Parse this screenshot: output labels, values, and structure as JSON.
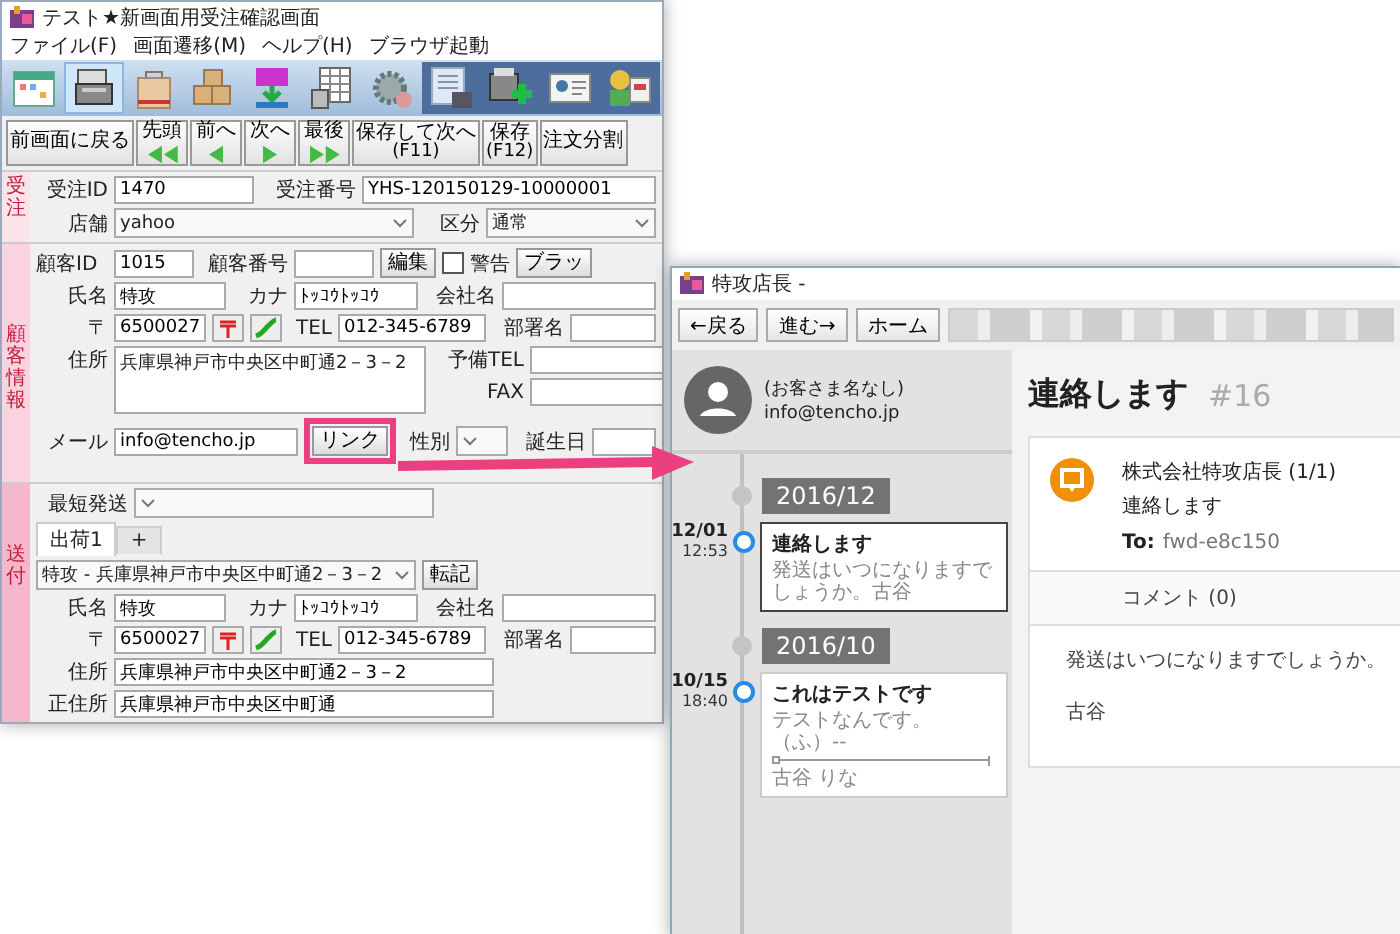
{
  "left_window": {
    "title": "テスト★新画面用受注確認画面",
    "menu": [
      "ファイル(F)",
      "画面遷移(M)",
      "ヘルプ(H)",
      "ブラウザ起動"
    ],
    "toolbar": [
      {
        "kind": "calendar",
        "selected": false,
        "dark": false
      },
      {
        "kind": "register",
        "selected": true,
        "dark": false
      },
      {
        "kind": "bag",
        "selected": false,
        "dark": false
      },
      {
        "kind": "boxes",
        "selected": false,
        "dark": false
      },
      {
        "kind": "download",
        "selected": false,
        "dark": false
      },
      {
        "kind": "sheet",
        "selected": false,
        "dark": false
      },
      {
        "kind": "gear",
        "selected": false,
        "dark": false
      },
      {
        "kind": "document",
        "selected": false,
        "dark": true
      },
      {
        "kind": "register-plus",
        "selected": false,
        "dark": true
      },
      {
        "kind": "card",
        "selected": false,
        "dark": true
      },
      {
        "kind": "person",
        "selected": false,
        "dark": true
      }
    ],
    "nav_buttons": [
      {
        "kind": "plain",
        "label": "前画面に戻る"
      },
      {
        "kind": "first",
        "label": "先頭"
      },
      {
        "kind": "prev",
        "label": "前へ"
      },
      {
        "kind": "next",
        "label": "次へ"
      },
      {
        "kind": "last",
        "label": "最後"
      },
      {
        "kind": "two-line",
        "label": "保存して次へ",
        "sub": "(F11)"
      },
      {
        "kind": "two-line",
        "label": "保存",
        "sub": "(F12)"
      },
      {
        "kind": "plain",
        "label": "注文分割"
      }
    ],
    "order": {
      "label": "受注",
      "order_id_label": "受注ID",
      "order_id": "1470",
      "order_no_label": "受注番号",
      "order_no": "YHS-120150129-10000001",
      "shop_label": "店舗",
      "shop": "yahoo",
      "category_label": "区分",
      "category": "通常"
    },
    "customer": {
      "label": "顧客情報",
      "id_label": "顧客ID",
      "id": "1015",
      "number_label": "顧客番号",
      "edit_button": "編集",
      "warning": {
        "label": "警告",
        "checked": false
      },
      "black_button": "ブラッ",
      "name_label": "氏名",
      "name": "特攻",
      "kana_label": "カナ",
      "kana": "ﾄｯｺｳﾄｯｺｳ",
      "company_label": "会社名",
      "zip_label": "〒",
      "zip": "6500027",
      "tel_label": "TEL",
      "tel": "012-345-6789",
      "department_label": "部署名",
      "address_label": "住所",
      "address": "兵庫県神戸市中央区中町通2－3－2",
      "spare_tel_label": "予備TEL",
      "fax_label": "FAX",
      "mail_label": "メール",
      "mail": "info@tencho.jp",
      "link_button": "リンク",
      "gender_label": "性別",
      "birthday_label": "誕生日"
    },
    "shipping": {
      "label": "送付",
      "method_label": "最短発送",
      "tabs": [
        {
          "label": "出荷1",
          "selected": true
        },
        {
          "label": "+",
          "selected": false
        }
      ],
      "destination": "特攻 - 兵庫県神戸市中央区中町通2－3－2",
      "copy_button": "転記",
      "name_label": "氏名",
      "name": "特攻",
      "kana_label": "カナ",
      "kana": "ﾄｯｺｳﾄｯｺｳ",
      "company_label": "会社名",
      "zip_label": "〒",
      "zip": "6500027",
      "tel_label": "TEL",
      "tel": "012-345-6789",
      "department_label": "部署名",
      "address_label": "住所",
      "address": "兵庫県神戸市中央区中町通2－3－2",
      "official_address_label": "正住所",
      "official_address": "兵庫県神戸市中央区中町通"
    }
  },
  "right_window": {
    "title": "特攻店長 -",
    "nav": [
      "←戻る",
      "進む→",
      "ホーム"
    ],
    "customer": {
      "name": "(お客さま名なし)",
      "email": "info@tencho.jp"
    },
    "timeline": [
      {
        "month": "2016/12",
        "items": [
          {
            "date": "12/01",
            "time": "12:53",
            "title": "連絡します",
            "lines": [
              "発送はいつになりますでしょうか。古谷"
            ],
            "selected": true
          }
        ]
      },
      {
        "month": "2016/10",
        "items": [
          {
            "date": "10/15",
            "time": "18:40",
            "title": "これはテストです",
            "lines": [
              "テストなんです。（ふ）--",
              "古谷 りな"
            ],
            "selected": false
          }
        ]
      }
    ],
    "ticket": {
      "title": "連絡します",
      "number": "#16",
      "sender": "株式会社特攻店長 (1/1)",
      "subject": "連絡します",
      "to_label": "To:",
      "to": "fwd-e8c150",
      "comments": "コメント (0)",
      "body": [
        "発送はいつになりますでしょうか。",
        "古谷"
      ]
    }
  }
}
